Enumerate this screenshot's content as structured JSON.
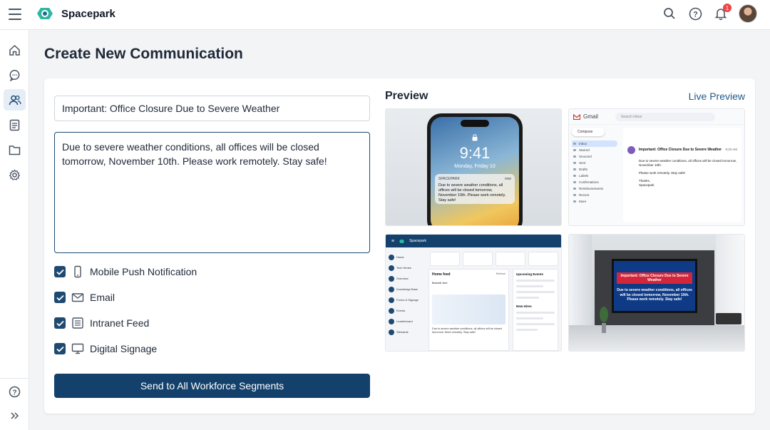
{
  "app": {
    "name": "Spacepark",
    "notification_count": "1"
  },
  "page": {
    "title": "Create New Communication"
  },
  "form": {
    "subject": "Important: Office Closure Due to Severe Weather",
    "body": "Due to severe weather conditions, all offices will be closed tomorrow, November 10th. Please work remotely. Stay safe!",
    "channels": [
      {
        "label": "Mobile Push Notification",
        "icon": "smartphone-icon",
        "checked": true
      },
      {
        "label": "Email",
        "icon": "mail-icon",
        "checked": true
      },
      {
        "label": "Intranet Feed",
        "icon": "feed-icon",
        "checked": true
      },
      {
        "label": "Digital Signage",
        "icon": "monitor-icon",
        "checked": true
      }
    ],
    "send_label": "Send to All Workforce Segments"
  },
  "preview": {
    "title": "Preview",
    "live_label": "Live Preview",
    "phone": {
      "time": "9:41",
      "date": "Monday, Friday 10",
      "app": "SPACEPARK",
      "ago": "now",
      "text": "Due to severe weather conditions, all offices will be closed tomorrow, November 10th. Please work remotely. Stay safe!"
    },
    "gmail": {
      "brand": "Gmail",
      "search": "Search Inbox",
      "compose": "Compose",
      "folders": [
        "Inbox",
        "Starred",
        "Snoozed",
        "Sent",
        "Drafts",
        "Labels",
        "Confirmations",
        "Reimbursements",
        "Recent",
        "More"
      ],
      "subject": "Important: Office Closure Due to Severe Weather",
      "time": "9:20 AM",
      "body": "Due to severe weather conditions, all offices will be closed tomorrow, November 10th.",
      "body2": "Please work remotely. Stay safe!",
      "signoff": "Thanks,",
      "sender": "Spacepark"
    },
    "intranet": {
      "brand": "Spacepark",
      "nav": [
        "Home",
        "Tech Series",
        "Overview",
        "Knowledge Base",
        "Forms & Signage",
        "Events",
        "Leaderboard",
        "Stewards"
      ],
      "feed_title": "Home feed",
      "refresh": "Refresh",
      "post_author": "Burnett Joni",
      "event_title": "Upcoming Events",
      "news_title": "New Hires",
      "post_text": "Due to severe weather conditions, all offices will be closed tomorrow. Work remotely. Stay safe!"
    },
    "signage": {
      "headline": "Important: Office Closure Due to Severe Weather",
      "text": "Due to severe weather conditions, all offices will be closed tomorrow, November 10th. Please work remotely. Stay safe!"
    }
  }
}
